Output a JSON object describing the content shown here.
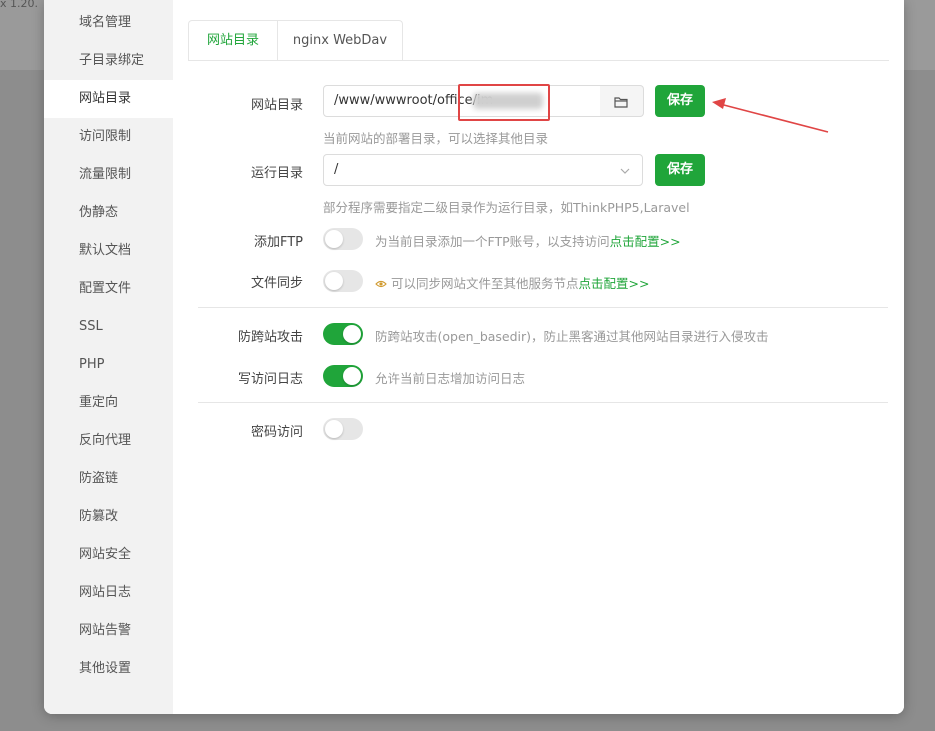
{
  "background": {
    "corner_text": "x 1.20."
  },
  "sidebar": {
    "items": [
      {
        "label": "域名管理"
      },
      {
        "label": "子目录绑定"
      },
      {
        "label": "网站目录",
        "active": true
      },
      {
        "label": "访问限制"
      },
      {
        "label": "流量限制"
      },
      {
        "label": "伪静态"
      },
      {
        "label": "默认文档"
      },
      {
        "label": "配置文件"
      },
      {
        "label": "SSL"
      },
      {
        "label": "PHP"
      },
      {
        "label": "重定向"
      },
      {
        "label": "反向代理"
      },
      {
        "label": "防盗链"
      },
      {
        "label": "防篡改"
      },
      {
        "label": "网站安全"
      },
      {
        "label": "网站日志"
      },
      {
        "label": "网站告警"
      },
      {
        "label": "其他设置"
      }
    ]
  },
  "tabs": [
    {
      "label": "网站目录",
      "active": true
    },
    {
      "label": "nginx WebDav"
    }
  ],
  "site_dir": {
    "label": "网站目录",
    "value": "/www/wwwroot/office/im",
    "hint": "当前网站的部署目录，可以选择其他目录",
    "save_label": "保存",
    "folder_icon": "folder-icon"
  },
  "run_dir": {
    "label": "运行目录",
    "value": "/",
    "hint": "部分程序需要指定二级目录作为运行目录，如ThinkPHP5,Laravel",
    "save_label": "保存"
  },
  "add_ftp": {
    "label": "添加FTP",
    "hint_prefix": "为当前目录添加一个FTP账号，以支持访问",
    "link": "点击配置>>",
    "enabled": false
  },
  "file_sync": {
    "label": "文件同步",
    "hint_prefix": "可以同步网站文件至其他服务节点",
    "link": "点击配置>>",
    "icon": "eye-icon",
    "enabled": false
  },
  "anti_xss": {
    "label": "防跨站攻击",
    "hint": "防跨站攻击(open_basedir)，防止黑客通过其他网站目录进行入侵攻击",
    "enabled": true
  },
  "access_log": {
    "label": "写访问日志",
    "hint": "允许当前日志增加访问日志",
    "enabled": true
  },
  "password_access": {
    "label": "密码访问",
    "enabled": false
  },
  "colors": {
    "accent": "#20a53a",
    "annotation": "#e04545"
  }
}
